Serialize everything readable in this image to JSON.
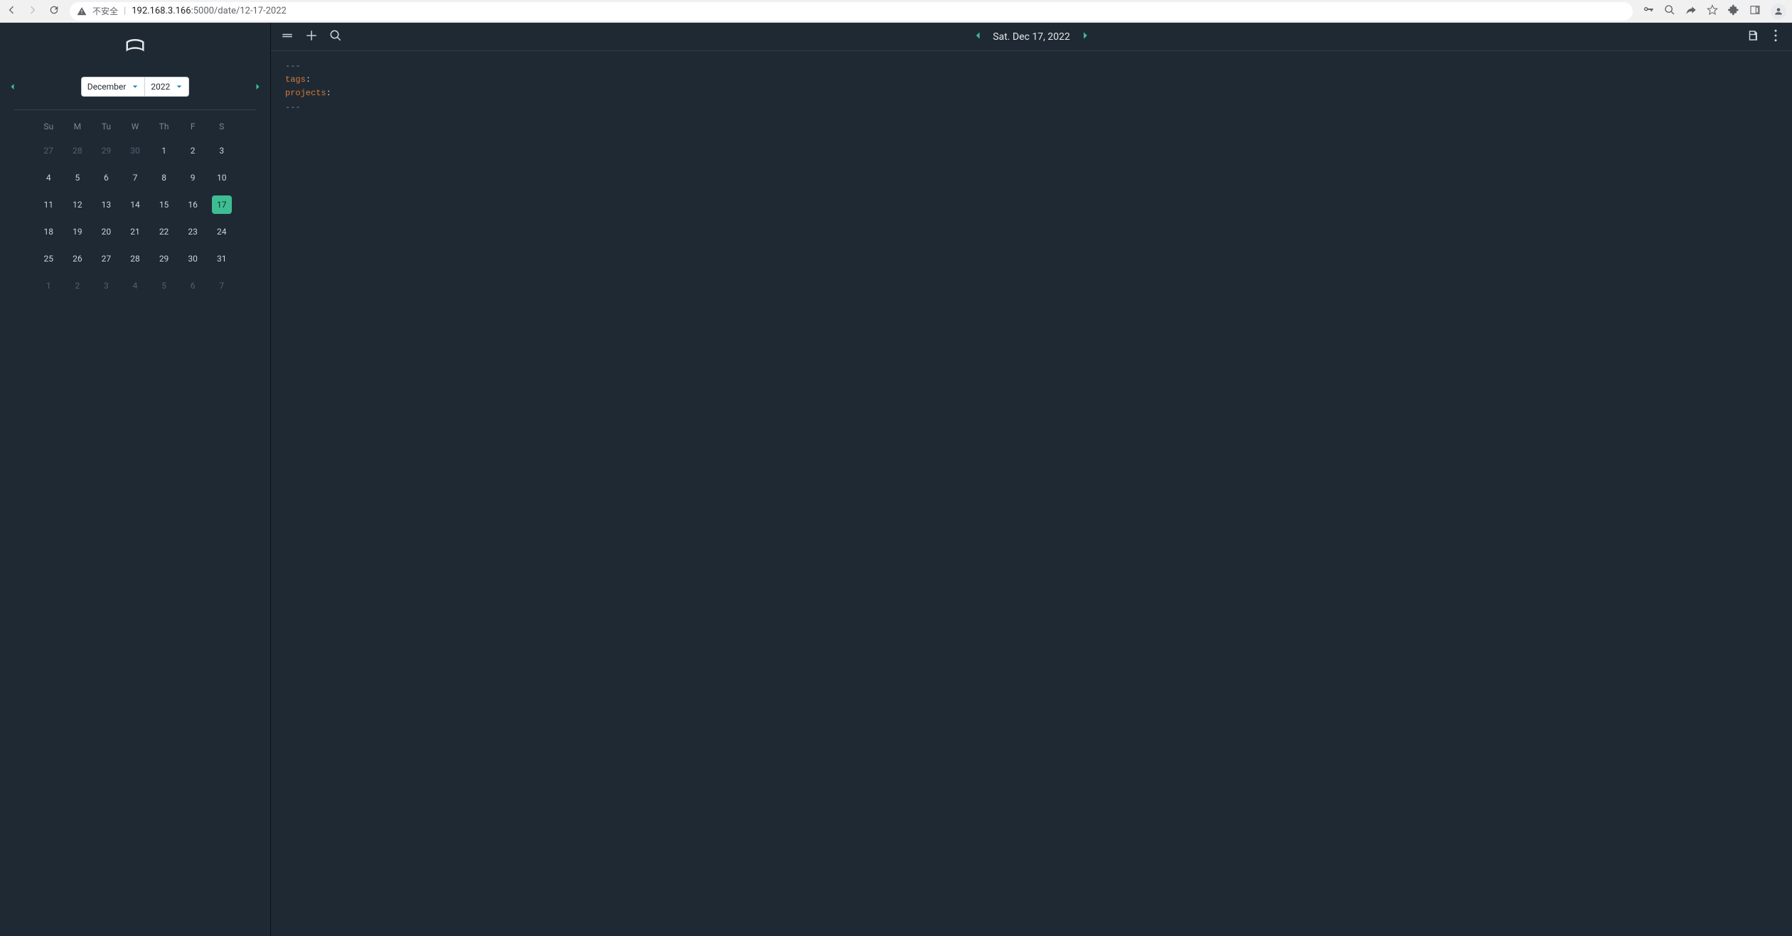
{
  "browser": {
    "insecure_label": "不安全",
    "host": "192.168.3.166",
    "port_path": ":5000/date/12-17-2022"
  },
  "sidebar": {
    "month_select": "December",
    "year_select": "2022",
    "day_headers": [
      "Su",
      "M",
      "Tu",
      "W",
      "Th",
      "F",
      "S"
    ],
    "weeks": [
      [
        {
          "d": "27",
          "other": true
        },
        {
          "d": "28",
          "other": true
        },
        {
          "d": "29",
          "other": true
        },
        {
          "d": "30",
          "other": true
        },
        {
          "d": "1"
        },
        {
          "d": "2"
        },
        {
          "d": "3"
        }
      ],
      [
        {
          "d": "4"
        },
        {
          "d": "5"
        },
        {
          "d": "6"
        },
        {
          "d": "7"
        },
        {
          "d": "8"
        },
        {
          "d": "9"
        },
        {
          "d": "10"
        }
      ],
      [
        {
          "d": "11"
        },
        {
          "d": "12"
        },
        {
          "d": "13"
        },
        {
          "d": "14"
        },
        {
          "d": "15"
        },
        {
          "d": "16"
        },
        {
          "d": "17",
          "selected": true
        }
      ],
      [
        {
          "d": "18"
        },
        {
          "d": "19"
        },
        {
          "d": "20"
        },
        {
          "d": "21"
        },
        {
          "d": "22"
        },
        {
          "d": "23"
        },
        {
          "d": "24"
        }
      ],
      [
        {
          "d": "25"
        },
        {
          "d": "26"
        },
        {
          "d": "27"
        },
        {
          "d": "28"
        },
        {
          "d": "29"
        },
        {
          "d": "30"
        },
        {
          "d": "31"
        }
      ],
      [
        {
          "d": "1",
          "other": true
        },
        {
          "d": "2",
          "other": true
        },
        {
          "d": "3",
          "other": true
        },
        {
          "d": "4",
          "other": true
        },
        {
          "d": "5",
          "other": true
        },
        {
          "d": "6",
          "other": true
        },
        {
          "d": "7",
          "other": true
        }
      ]
    ]
  },
  "header": {
    "date_label": "Sat. Dec 17, 2022"
  },
  "editor": {
    "delim": "---",
    "line1_key": "tags",
    "line2_key": "projects",
    "colon": ":"
  }
}
